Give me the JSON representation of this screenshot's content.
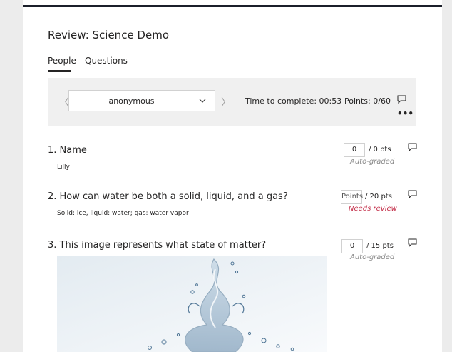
{
  "header": {
    "title": "Review: Science Demo",
    "tabs": [
      {
        "label": "People",
        "active": true
      },
      {
        "label": "Questions",
        "active": false
      }
    ]
  },
  "toolbar": {
    "prev_icon": "chevron-left-icon",
    "next_icon": "chevron-right-icon",
    "respondent": "anonymous",
    "time_to_complete": "Time to complete: 00:53",
    "points": "Points: 0/60",
    "more_label": "•••"
  },
  "questions": [
    {
      "title": "1. Name",
      "answer": "Lilly",
      "score_value": "0",
      "score_total": "/ 0 pts",
      "status": "Auto-graded"
    },
    {
      "title": "2. How can water be both a solid, liquid, and a gas?",
      "answer": "Solid: ice, liquid: water; gas: water vapor",
      "score_placeholder": "Points",
      "score_total": "/ 20 pts",
      "status": "Needs review"
    },
    {
      "title": "3. This image represents what state of matter?",
      "score_value": "0",
      "score_total": "/ 15 pts",
      "status": "Auto-graded"
    }
  ],
  "colors": {
    "needs_review": "#c4314b",
    "toolbar_bg": "#f0f0f0",
    "top_bar": "#1b1f2a"
  }
}
